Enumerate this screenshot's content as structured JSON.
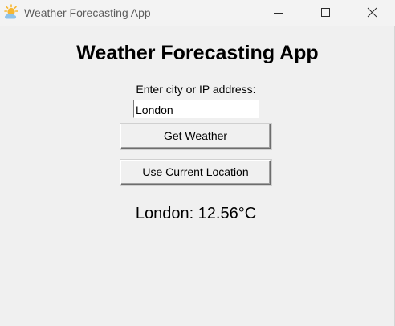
{
  "window": {
    "title": "Weather Forecasting App",
    "icon": "partly-cloudy-sun-icon",
    "controls": [
      "minimize-icon",
      "maximize-icon",
      "close-icon"
    ]
  },
  "main": {
    "heading": "Weather Forecasting App",
    "prompt_label": "Enter city or IP address:",
    "city_input_value": "London",
    "get_weather_label": "Get Weather",
    "use_location_label": "Use Current Location",
    "result_text": "London: 12.56°C"
  },
  "colors": {
    "background": "#f0f0f0",
    "sun": "#f7b731",
    "cloud": "#8fc3ea"
  }
}
